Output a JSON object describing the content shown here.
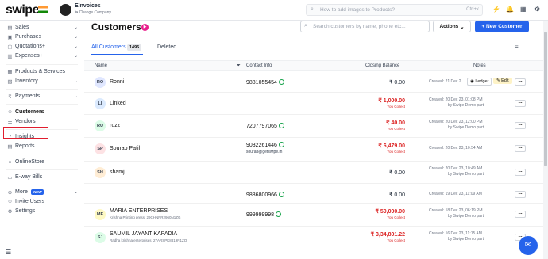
{
  "app": {
    "logo": "swipe",
    "company_name": "EInvoices",
    "change_company": "Change Company",
    "search_placeholder": "How to add images to Products?",
    "search_shortcut": "Ctrl+k"
  },
  "sidebar": {
    "items": [
      {
        "label": "Sales",
        "icon": "file-icon"
      },
      {
        "label": "Purchases",
        "icon": "cart-icon"
      },
      {
        "label": "Quotations+",
        "icon": "doc-icon"
      },
      {
        "label": "Expenses+",
        "icon": "wallet-icon"
      },
      {
        "label": "Products & Services",
        "icon": "box-icon"
      },
      {
        "label": "Inventory",
        "icon": "inventory-icon"
      },
      {
        "label": "Payments",
        "icon": "rupee-icon"
      },
      {
        "label": "Customers",
        "icon": "user-icon"
      },
      {
        "label": "Vendors",
        "icon": "vendor-icon"
      },
      {
        "label": "Insights",
        "icon": "insights-icon"
      },
      {
        "label": "Reports",
        "icon": "reports-icon"
      },
      {
        "label": "OnlineStore",
        "icon": "store-icon"
      },
      {
        "label": "E-way Bills",
        "icon": "truck-icon"
      },
      {
        "label": "More",
        "icon": "plus-icon",
        "badge": "NEW"
      },
      {
        "label": "Invite Users",
        "icon": "invite-icon"
      },
      {
        "label": "Settings",
        "icon": "gear-icon"
      }
    ]
  },
  "page": {
    "title": "Customers",
    "search_placeholder": "Search customers by name, phone etc...",
    "actions_label": "Actions",
    "new_button": "+ New Customer",
    "tab_all": "All Customers",
    "tab_all_count": "1495",
    "tab_deleted": "Deleted"
  },
  "table": {
    "headers": {
      "name": "Name",
      "contact": "Contact Info",
      "balance": "Closing Balance",
      "notes": "Notes"
    },
    "you_collect": "You Collect",
    "ledger_label": "Ledger",
    "edit_label": "Edit",
    "rows": [
      {
        "initials": "RO",
        "color": "#e0e7ff",
        "name": "Ronni",
        "sub": "",
        "phone": "9881055454",
        "wa": true,
        "email": "",
        "balance": "₹ 0.00",
        "red": false,
        "note1": "Created: 21 Dec 2",
        "note2": "",
        "ledger": true
      },
      {
        "initials": "LI",
        "color": "#dbeafe",
        "name": "Linked",
        "sub": "",
        "phone": "",
        "wa": false,
        "email": "",
        "balance": "₹ 1,000.00",
        "red": true,
        "note1": "Created: 20 Dec 23, 01:08 PM",
        "note2": "by Swipe Demo part",
        "ledger": false
      },
      {
        "initials": "RU",
        "color": "#dcfce7",
        "name": "ruzz",
        "sub": "",
        "phone": "7207797065",
        "wa": true,
        "email": "",
        "balance": "₹ 40.00",
        "red": true,
        "note1": "Created: 20 Dec 23, 12:00 PM",
        "note2": "by Swipe Demo part",
        "ledger": false
      },
      {
        "initials": "SP",
        "color": "#fde2e4",
        "name": "Sourab Patil",
        "sub": "",
        "phone": "9032261446",
        "wa": true,
        "email": "sourab@getswipe.in",
        "balance": "₹ 6,479.00",
        "red": true,
        "note1": "Created: 20 Dec 23, 10:54 AM",
        "note2": "",
        "ledger": false
      },
      {
        "initials": "SH",
        "color": "#ffedd5",
        "name": "shamji",
        "sub": "",
        "phone": "",
        "wa": false,
        "email": "",
        "balance": "₹ 0.00",
        "red": false,
        "note1": "Created: 20 Dec 23, 10:49 AM",
        "note2": "by Swipe Demo part",
        "ledger": false
      },
      {
        "initials": "",
        "color": "#ffffff",
        "name": "",
        "sub": "",
        "phone": "9886800966",
        "wa": true,
        "email": "",
        "balance": "₹ 0.00",
        "red": false,
        "note1": "Created: 19 Dec 23, 11:09 AM",
        "note2": "",
        "ledger": false
      },
      {
        "initials": "ME",
        "color": "#fef9c3",
        "name": "MARIA ENTERPRISES",
        "sub": "Krishna Printing press, 29CHNPR2960N1ZG",
        "phone": "999999998",
        "wa": true,
        "email": "",
        "balance": "₹ 50,000.00",
        "red": true,
        "note1": "Created: 18 Dec 23, 06:19 PM",
        "note2": "by Swipe Demo part",
        "ledger": false
      },
      {
        "initials": "SJ",
        "color": "#dcfce7",
        "name": "SAUMIL JAYANT KAPADIA",
        "sub": "Radha krishna enterprises, 27ARSPK8819N1ZQ",
        "phone": "",
        "wa": false,
        "email": "",
        "balance": "₹ 3,34,801.22",
        "red": true,
        "note1": "Created: 16 Dec 23, 11:15 AM",
        "note2": "by Swipe Demo part",
        "ledger": false
      }
    ]
  }
}
